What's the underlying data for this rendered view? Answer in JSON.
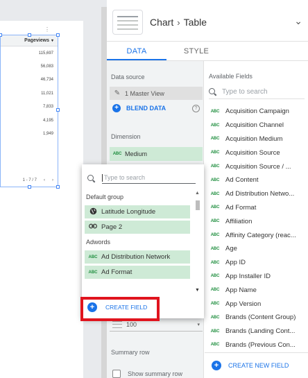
{
  "table": {
    "header": "Pageviews",
    "values": [
      "115,697",
      "56,083",
      "46,734",
      "11,021",
      "7,833",
      "4,195",
      "1,949"
    ],
    "pagination": "1 - 7 / 7"
  },
  "panel": {
    "breadcrumb_chart": "Chart",
    "breadcrumb_type": "Table",
    "tabs": [
      "DATA",
      "STYLE"
    ],
    "data_source_title": "Data source",
    "data_source_name": "1 Master View",
    "blend_label": "BLEND DATA",
    "dimension_title": "Dimension",
    "dimension_value": "Medium",
    "rows_per_page": "100",
    "summary_title": "Summary row",
    "summary_label": "Show summary row"
  },
  "available": {
    "title": "Available Fields",
    "search_placeholder": "Type to search",
    "fields": [
      "Acquisition Campaign",
      "Acquisition Channel",
      "Acquisition Medium",
      "Acquisition Source",
      "Acquisition Source / ...",
      "Ad Content",
      "Ad Distribution Netwo...",
      "Ad Format",
      "Affiliation",
      "Affinity Category (reac...",
      "Age",
      "App ID",
      "App Installer ID",
      "App Name",
      "App Version",
      "Brands (Content Group)",
      "Brands (Landing Cont...",
      "Brands (Previous Con..."
    ],
    "type_tag": "ABC",
    "create_new_label": "CREATE NEW FIELD"
  },
  "popup": {
    "search_placeholder": "Type to search",
    "groups": [
      {
        "label": "Default group",
        "items": [
          {
            "label": "Latitude Longitude",
            "icon": "globe-icon"
          },
          {
            "label": "Page 2",
            "icon": "link-icon"
          }
        ]
      },
      {
        "label": "Adwords",
        "items": [
          {
            "label": "Ad Distribution Network",
            "icon": "abc-text-icon"
          },
          {
            "label": "Ad Format",
            "icon": "abc-text-icon"
          }
        ]
      }
    ],
    "create_field_label": "CREATE FIELD"
  },
  "colors": {
    "accent": "#1a73e8",
    "dimension_chip": "#ceead6",
    "highlight": "#e0141e"
  }
}
